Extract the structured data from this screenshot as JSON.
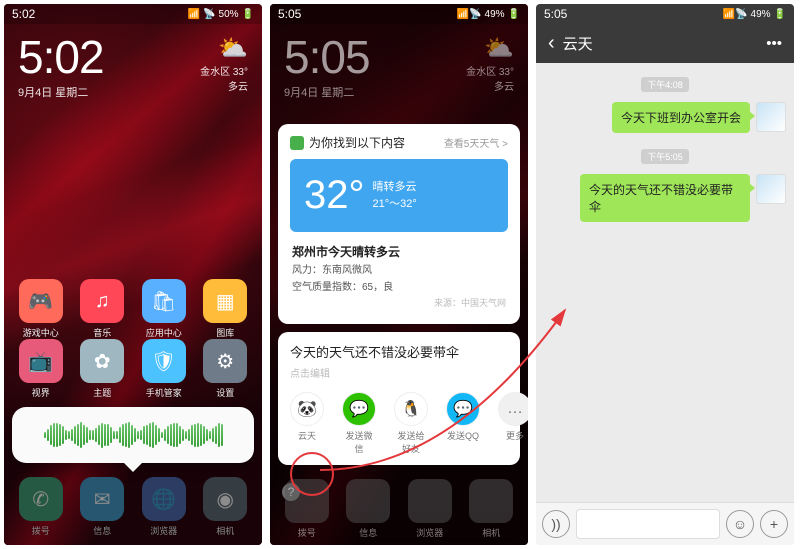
{
  "s1": {
    "status": {
      "time": "5:02",
      "battery": "50%",
      "signal": "⁴ᴳ ▯▯▯"
    },
    "clock": {
      "time": "5:02",
      "date": "9月4日  星期二"
    },
    "weather": {
      "loc_temp": "金水区 33°",
      "cond": "多云"
    },
    "apps_row1": [
      {
        "label": "游戏中心",
        "glyph": "🎮",
        "bg": "#ff6a5b"
      },
      {
        "label": "音乐",
        "glyph": "♫",
        "bg": "#ff4757"
      },
      {
        "label": "应用中心",
        "glyph": "🛍",
        "bg": "#58b0ff"
      },
      {
        "label": "图库",
        "glyph": "▦",
        "bg": "#ffbc3b"
      }
    ],
    "apps_row2": [
      {
        "label": "视界",
        "glyph": "📺",
        "bg": "#e85a7a"
      },
      {
        "label": "主题",
        "glyph": "✿",
        "bg": "#9eb7c0"
      },
      {
        "label": "手机管家",
        "glyph": "🛡",
        "bg": "#4cc2ff"
      },
      {
        "label": "设置",
        "glyph": "⚙",
        "bg": "#6f7b88"
      }
    ],
    "dock": [
      {
        "label": "拨号",
        "glyph": "✆",
        "bg": "#13b26f"
      },
      {
        "label": "信息",
        "glyph": "✉",
        "bg": "#18a9f3"
      },
      {
        "label": "浏览器",
        "glyph": "🌐",
        "bg": "#3f6de0"
      },
      {
        "label": "相机",
        "glyph": "◉",
        "bg": "#5a6e82"
      }
    ]
  },
  "s2": {
    "status": {
      "time": "5:05",
      "battery": "49%"
    },
    "clock": {
      "time": "5:05",
      "date": "9月4日  星期二"
    },
    "weather_mini": {
      "loc_temp": "金水区 33°",
      "cond": "多云"
    },
    "card_head": {
      "left": "为你找到以下内容",
      "right": "查看5天天气 >"
    },
    "wcard": {
      "temp": "32°",
      "desc1": "晴转多云",
      "range": "21°～32°",
      "title": "郑州市今天晴转多云",
      "wind": "风力：东南风微风",
      "aqi": "空气质量指数：65，良",
      "source": "来源：中国天气网"
    },
    "msg": {
      "text": "今天的天气还不错没必要带伞",
      "hint": "点击编辑"
    },
    "share": [
      {
        "label": "云天",
        "bg": "#fff",
        "glyph": "🐼"
      },
      {
        "label": "发送微信",
        "bg": "#2dc100",
        "glyph": "💬"
      },
      {
        "label": "发送给好友",
        "bg": "#fff",
        "glyph": "🐧"
      },
      {
        "label": "发送QQ",
        "bg": "#12b7f5",
        "glyph": "💬"
      },
      {
        "label": "更多",
        "bg": "#f0f0f0",
        "glyph": "…"
      }
    ],
    "dock": [
      {
        "label": "拨号"
      },
      {
        "label": "信息"
      },
      {
        "label": "浏览器"
      },
      {
        "label": "相机"
      }
    ]
  },
  "s3": {
    "status": {
      "time": "5:05",
      "battery": "49%"
    },
    "title": "云天",
    "msgs": [
      {
        "time": "下午4:08",
        "text": "今天下班到办公室开会"
      },
      {
        "time": "下午5:05",
        "text": "今天的天气还不错没必要带伞"
      }
    ]
  }
}
